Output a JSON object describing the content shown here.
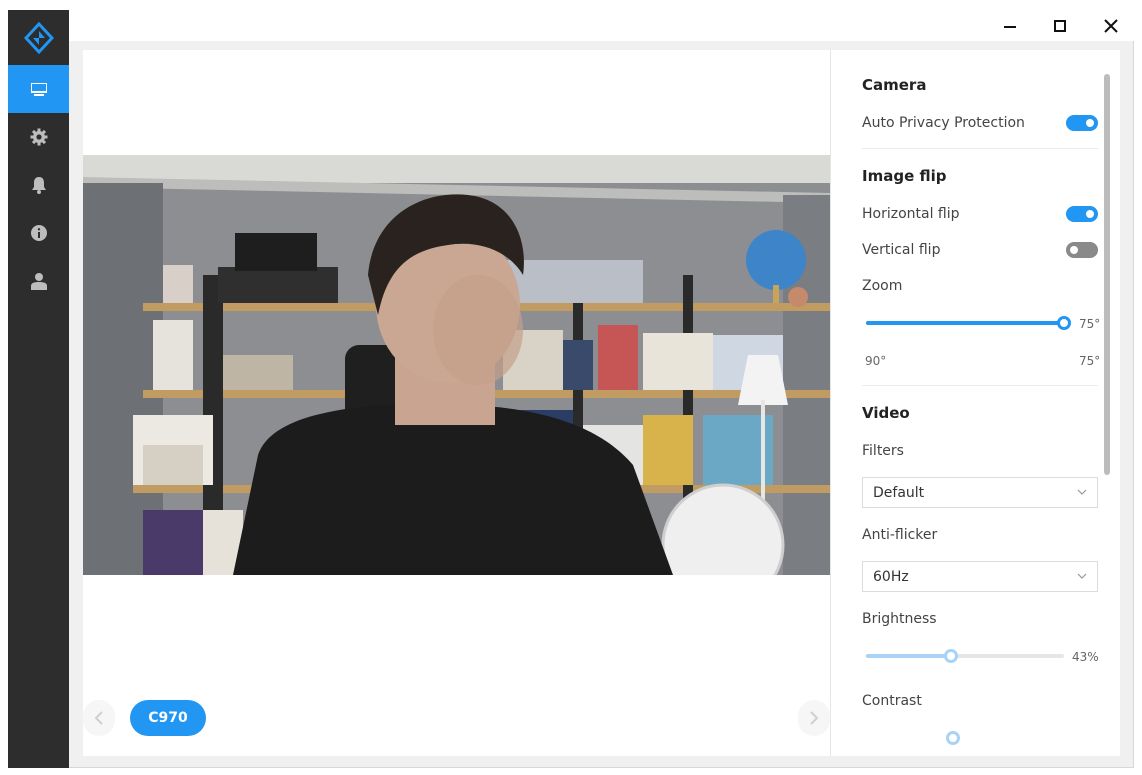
{
  "app": {
    "active_nav": "camera",
    "accent": "#2196f3"
  },
  "sidebar": {
    "items": [
      {
        "icon": "monitor-icon",
        "active": true
      },
      {
        "icon": "gear-icon",
        "active": false
      },
      {
        "icon": "bell-icon",
        "active": false
      },
      {
        "icon": "info-icon",
        "active": false
      },
      {
        "icon": "user-icon",
        "active": false
      }
    ]
  },
  "window_controls": {
    "minimize": "minimize-icon",
    "maximize": "maximize-icon",
    "close": "close-icon"
  },
  "preview": {
    "camera_name": "C970"
  },
  "settings": {
    "camera": {
      "title": "Camera",
      "auto_privacy_label": "Auto Privacy Protection",
      "auto_privacy_on": true
    },
    "image_flip": {
      "title": "Image flip",
      "horizontal_label": "Horizontal flip",
      "horizontal_on": true,
      "vertical_label": "Vertical flip",
      "vertical_on": false
    },
    "zoom": {
      "label": "Zoom",
      "value_text": "75°",
      "min_text": "90°",
      "max_text": "75°",
      "fraction": 1.0
    },
    "video": {
      "title": "Video",
      "filters_label": "Filters",
      "filters_value": "Default",
      "antiflicker_label": "Anti-flicker",
      "antiflicker_value": "60Hz",
      "brightness_label": "Brightness",
      "brightness_text": "43%",
      "brightness_fraction": 0.43,
      "contrast_label": "Contrast"
    }
  }
}
